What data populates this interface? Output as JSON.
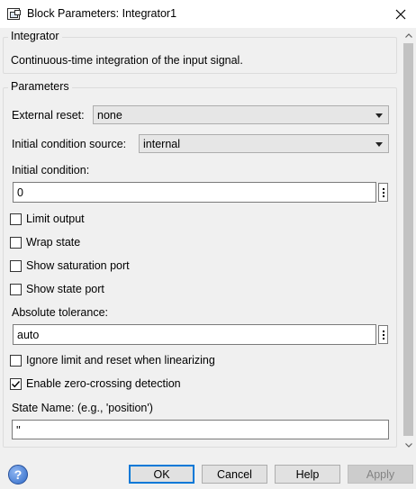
{
  "window": {
    "title": "Block Parameters: Integrator1",
    "close_icon": "close-icon"
  },
  "block": {
    "group_title": "Integrator",
    "description": "Continuous-time integration of the input signal."
  },
  "parameters": {
    "group_title": "Parameters",
    "external_reset": {
      "label": "External reset:",
      "value": "none"
    },
    "initial_condition_source": {
      "label": "Initial condition source:",
      "value": "internal"
    },
    "initial_condition": {
      "label": "Initial condition:",
      "value": "0"
    },
    "checkboxes_top": [
      {
        "label": "Limit output",
        "checked": false
      },
      {
        "label": "Wrap state",
        "checked": false
      },
      {
        "label": "Show saturation port",
        "checked": false
      },
      {
        "label": "Show state port",
        "checked": false
      }
    ],
    "absolute_tolerance": {
      "label": "Absolute tolerance:",
      "value": "auto"
    },
    "checkboxes_bottom": [
      {
        "label": "Ignore limit and reset when linearizing",
        "checked": false
      },
      {
        "label": "Enable zero-crossing detection",
        "checked": true
      }
    ],
    "state_name": {
      "label": "State Name: (e.g., 'position')",
      "value": "''"
    }
  },
  "buttons": {
    "ok": "OK",
    "cancel": "Cancel",
    "help": "Help",
    "apply": "Apply"
  },
  "colors": {
    "default_button_border": "#0078d7",
    "help_icon": "#2f6ac7",
    "dialog_bg": "#f0f0f0"
  }
}
